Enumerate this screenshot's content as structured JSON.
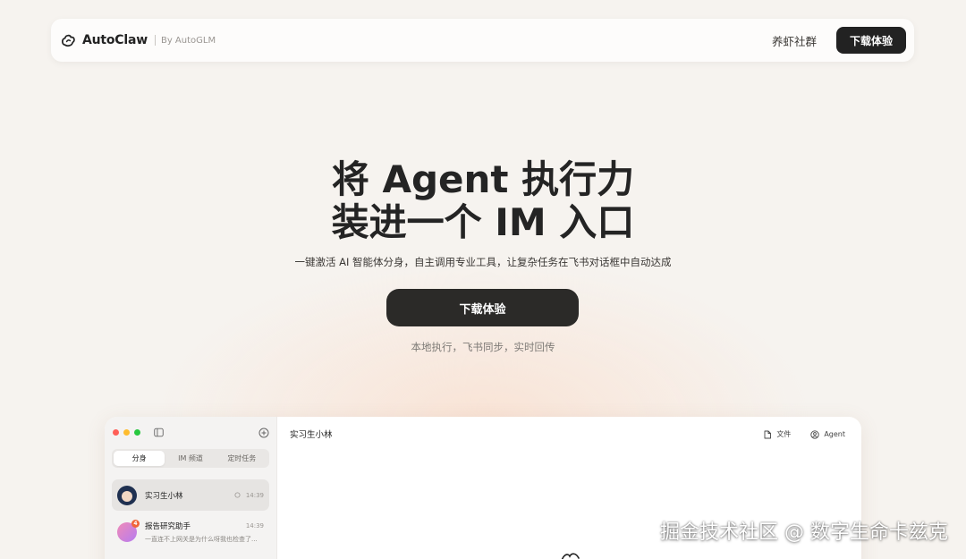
{
  "nav": {
    "brand": "AutoClaw",
    "byline": "By AutoGLM",
    "community": "养虾社群",
    "download": "下载体验",
    "logo_icon": "claw-logo-icon"
  },
  "hero": {
    "title_line1": "将 Agent 执行力",
    "title_line2": "装进一个 IM 入口",
    "subtitle": "一键激活 AI 智能体分身，自主调用专业工具，让复杂任务在飞书对话框中自动达成",
    "cta": "下载体验",
    "note": "本地执行，飞书同步，实时回传"
  },
  "app": {
    "traffic_colors": [
      "#ff5f57",
      "#febc2e",
      "#28c840"
    ],
    "tabs": [
      {
        "label": "分身",
        "active": true
      },
      {
        "label": "IM 频道",
        "active": false
      },
      {
        "label": "定时任务",
        "active": false
      }
    ],
    "chats": [
      {
        "name": "实习生小林",
        "time": "14:39",
        "preview": "",
        "active": true,
        "pinned": true
      },
      {
        "name": "报告研究助手",
        "time": "14:39",
        "preview": "一直连不上网关是为什么呀我也检查了...",
        "active": false,
        "badge": "4"
      }
    ],
    "main": {
      "title": "实习生小林",
      "actions": [
        {
          "label": "文件",
          "icon": "file-icon"
        },
        {
          "label": "Agent",
          "icon": "agent-icon"
        }
      ]
    }
  },
  "watermark": "掘金技术社区 @ 数字生命卡兹克"
}
